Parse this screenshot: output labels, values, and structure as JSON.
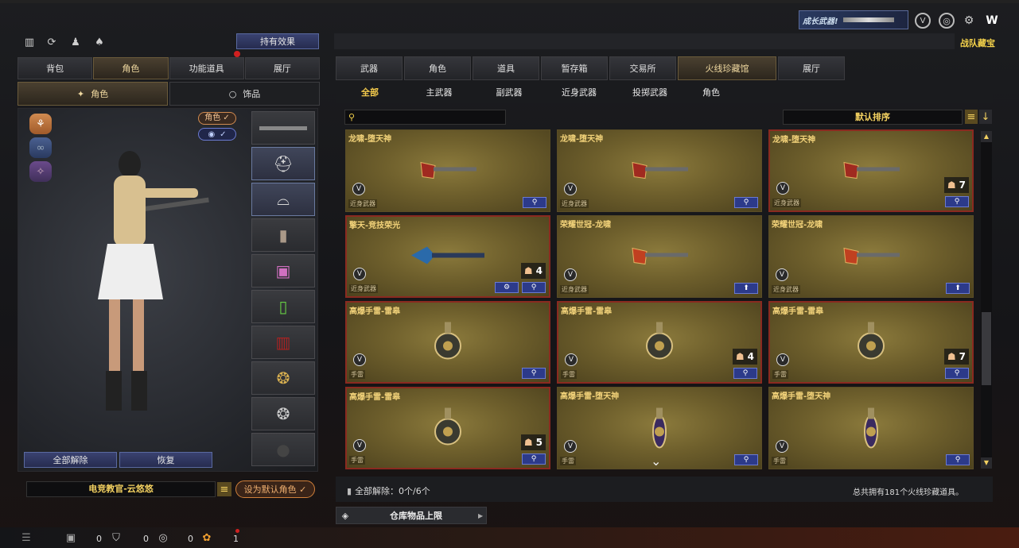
{
  "top_right": {
    "growth_weapon_label": "成长武器!",
    "team_text": "战队藏宝"
  },
  "left": {
    "quick_icons": [
      "stats-icon",
      "refresh-icon",
      "character-icon",
      "bag-icon"
    ],
    "hold_effect_button": "持有效果",
    "tabs": [
      {
        "label": "背包"
      },
      {
        "label": "角色",
        "active": true
      },
      {
        "label": "功能道具"
      },
      {
        "label": "展厅"
      }
    ],
    "subtabs": [
      {
        "label": "角色",
        "active": true
      },
      {
        "label": "饰品"
      }
    ],
    "char_tag": "角色 ✓",
    "toggle_tag": "✓",
    "buttons": {
      "unequip_all": "全部解除",
      "restore": "恢复"
    },
    "character_name": "电竞教官-云悠悠",
    "set_default": "设为默认角色 ✓"
  },
  "right": {
    "tabs": [
      {
        "label": "武器"
      },
      {
        "label": "角色"
      },
      {
        "label": "道具"
      },
      {
        "label": "暂存箱"
      },
      {
        "label": "交易所"
      },
      {
        "label": "火线珍藏馆",
        "active": true
      },
      {
        "label": "展厅"
      }
    ],
    "subtabs": [
      {
        "label": "全部",
        "active": true
      },
      {
        "label": "主武器"
      },
      {
        "label": "副武器"
      },
      {
        "label": "近身武器"
      },
      {
        "label": "投掷武器"
      },
      {
        "label": "角色"
      }
    ],
    "search_placeholder": "",
    "sort_label": "默认排序",
    "items": [
      {
        "name": "龙啸-堕天神",
        "cat": "近身武器",
        "count": "",
        "red": false,
        "art": "axe",
        "color": "#a02a20"
      },
      {
        "name": "龙啸-堕天神",
        "cat": "近身武器",
        "count": "",
        "red": false,
        "art": "axe",
        "color": "#a02a20"
      },
      {
        "name": "龙啸-堕天神",
        "cat": "近身武器",
        "count": "7",
        "red": true,
        "art": "axe",
        "color": "#a02a20"
      },
      {
        "name": "擎天-竞技荣光",
        "cat": "近身武器",
        "count": "4",
        "red": true,
        "art": "blue",
        "color": "#2a6aaa",
        "gear": true
      },
      {
        "name": "荣耀世冠-龙啸",
        "cat": "近身武器",
        "count": "",
        "red": false,
        "art": "axe2",
        "color": "#c04020",
        "up": true
      },
      {
        "name": "荣耀世冠-龙啸",
        "cat": "近身武器",
        "count": "",
        "red": false,
        "art": "axe2",
        "color": "#c04020",
        "up": true
      },
      {
        "name": "高爆手雷-雷皋",
        "cat": "手雷",
        "count": "",
        "red": true,
        "art": "grenade",
        "color": "#c0b070"
      },
      {
        "name": "高爆手雷-雷皋",
        "cat": "手雷",
        "count": "4",
        "red": true,
        "art": "grenade",
        "color": "#c0b070"
      },
      {
        "name": "高爆手雷-雷皋",
        "cat": "手雷",
        "count": "7",
        "red": true,
        "art": "grenade",
        "color": "#c0b070"
      },
      {
        "name": "高爆手雷-雷皋",
        "cat": "手雷",
        "count": "5",
        "red": true,
        "art": "grenade",
        "color": "#c0b070"
      },
      {
        "name": "高爆手雷-堕天神",
        "cat": "手雷",
        "count": "",
        "red": false,
        "art": "grenade2",
        "color": "#3a2a60"
      },
      {
        "name": "高爆手雷-堕天神",
        "cat": "手雷",
        "count": "",
        "red": false,
        "art": "grenade2",
        "color": "#3a2a60"
      }
    ],
    "footer_left": "全部解除：0个/6个",
    "footer_right": "总共拥有181个火线珍藏道具。",
    "storage_label": "仓库物品上限"
  },
  "bottom_bar": {
    "count1": "0",
    "count2": "0",
    "count3": "0",
    "count4": "1"
  }
}
